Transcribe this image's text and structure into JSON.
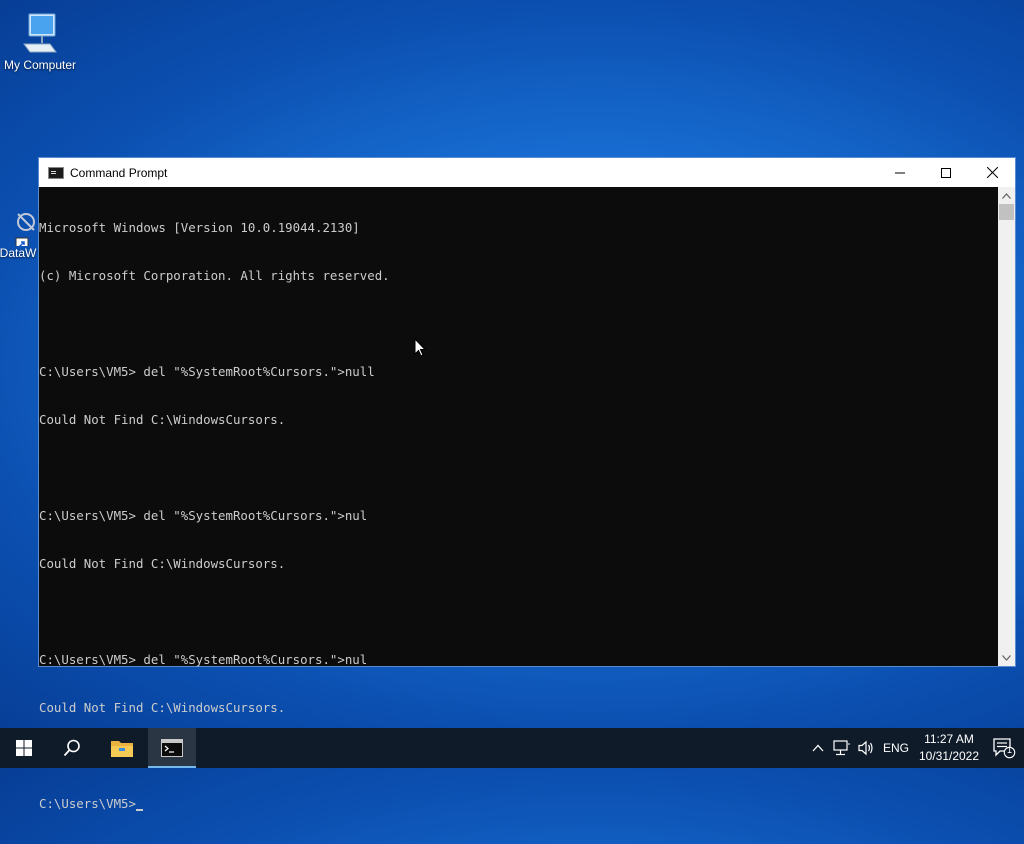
{
  "desktop": {
    "icons": [
      {
        "label": "My Computer"
      },
      {
        "label": "DataW"
      }
    ]
  },
  "window": {
    "title": "Command Prompt",
    "buttons": {
      "minimize": "—",
      "maximize": "☐",
      "close": "✕"
    },
    "lines": [
      "Microsoft Windows [Version 10.0.19044.2130]",
      "(c) Microsoft Corporation. All rights reserved.",
      "",
      "C:\\Users\\VM5> del \"%SystemRoot%Cursors.\">null",
      "Could Not Find C:\\WindowsCursors.",
      "",
      "C:\\Users\\VM5> del \"%SystemRoot%Cursors.\">nul",
      "Could Not Find C:\\WindowsCursors.",
      "",
      "C:\\Users\\VM5> del \"%SystemRoot%Cursors.\">nul",
      "Could Not Find C:\\WindowsCursors.",
      ""
    ],
    "prompt": "C:\\Users\\VM5>"
  },
  "taskbar": {
    "icons": [
      "windows-start-icon",
      "search-icon",
      "file-explorer-icon",
      "command-prompt-icon"
    ],
    "tray": {
      "language": "ENG",
      "time": "11:27 AM",
      "date": "10/31/2022",
      "notification_count": "1"
    }
  },
  "colors": {
    "console_bg": "#0c0c0c",
    "console_fg": "#cccccc",
    "taskbar_bg": "#101b2a",
    "desktop_blue": "#1a72d8"
  }
}
